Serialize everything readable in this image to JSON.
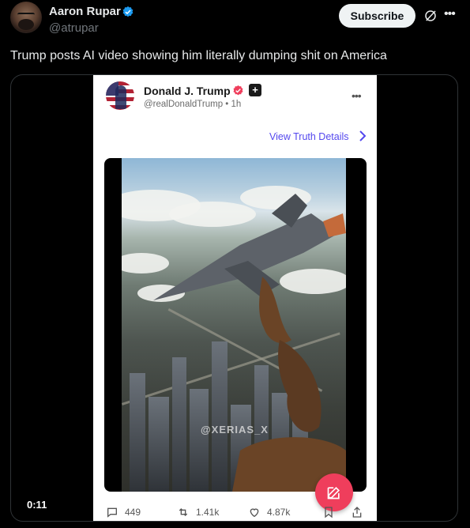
{
  "tweet": {
    "author_name": "Aaron Rupar",
    "author_handle": "@atrupar",
    "subscribe_label": "Subscribe",
    "text": "Trump posts AI video showing him literally dumping shit on America",
    "video_duration": "0:11",
    "verified_color": "#1d9bf0"
  },
  "truth_post": {
    "author_name": "Donald J. Trump",
    "author_handle": "@realDonaldTrump • 1h",
    "plus_badge": "+",
    "view_details_label": "View Truth Details",
    "watermark": "@XERIAS_X",
    "actions": {
      "replies": "449",
      "retruths": "1.41k",
      "likes": "4.87k"
    },
    "accent_color": "#5448ee",
    "fab_color": "#ef3e5c"
  },
  "icons": [
    "verified-badge-icon",
    "grok-icon",
    "more-icon",
    "chevron-right-icon",
    "compose-icon",
    "reply-icon",
    "retruth-icon",
    "like-icon",
    "bookmark-icon",
    "share-icon"
  ]
}
